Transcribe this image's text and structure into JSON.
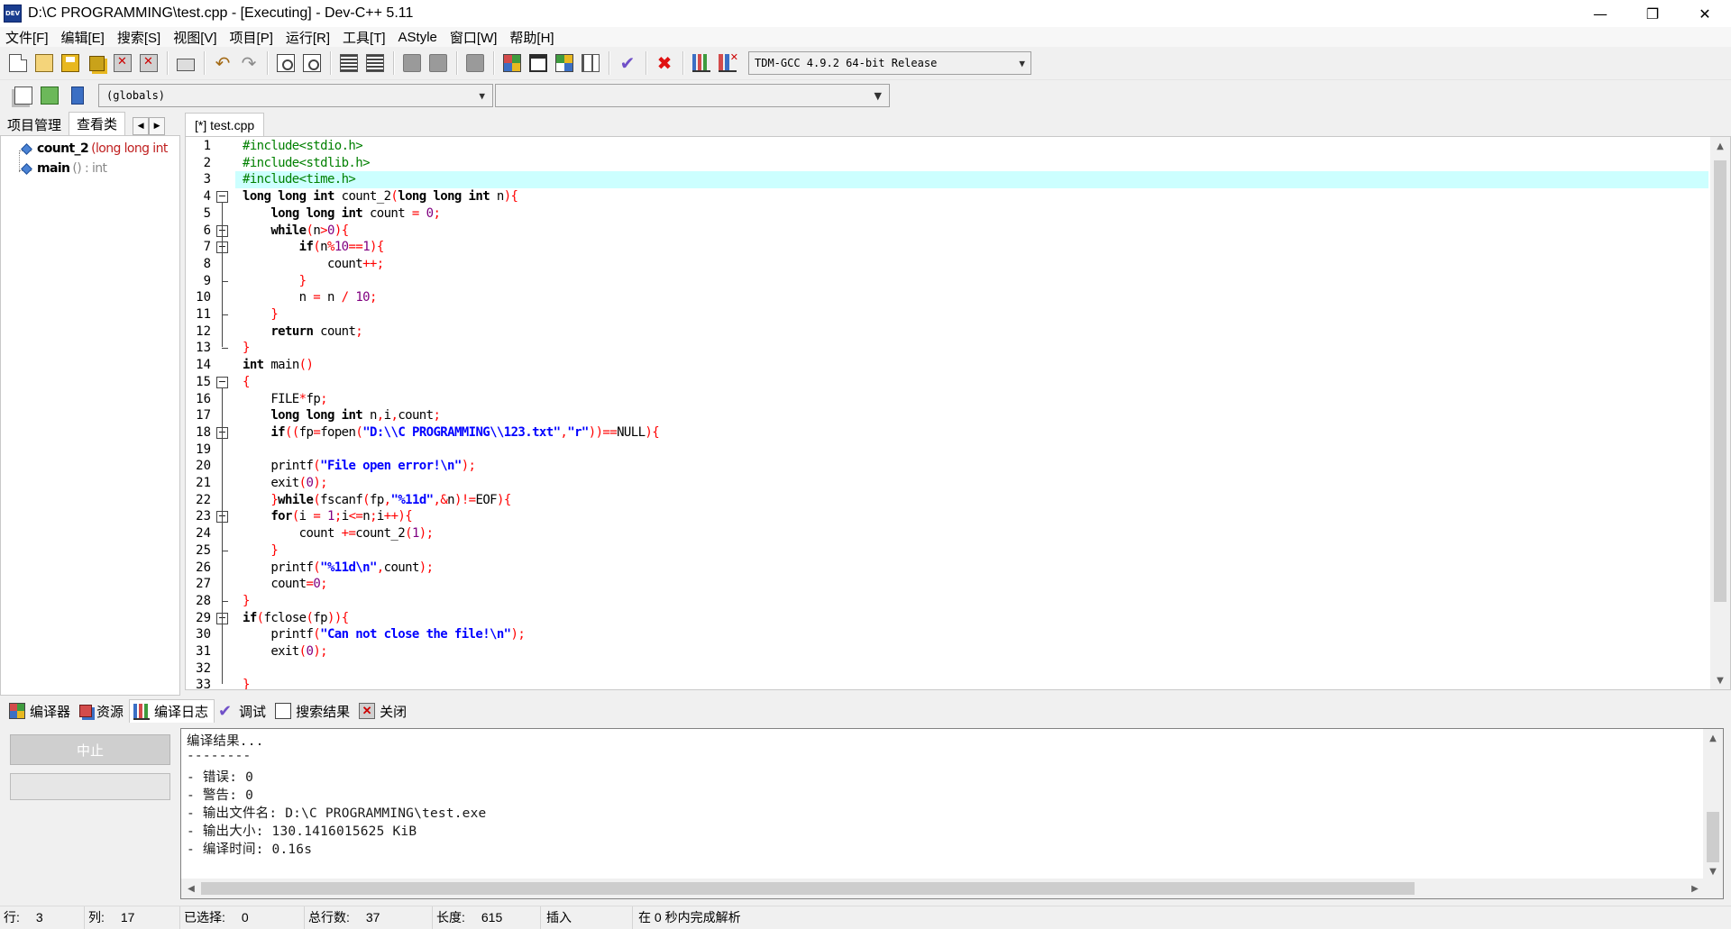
{
  "window": {
    "title": "D:\\C PROGRAMMING\\test.cpp - [Executing] - Dev-C++ 5.11",
    "logo_text": "DEV",
    "controls": {
      "minimize": "—",
      "restore": "❐",
      "close": "✕"
    }
  },
  "menu": [
    "文件[F]",
    "编辑[E]",
    "搜索[S]",
    "视图[V]",
    "项目[P]",
    "运行[R]",
    "工具[T]",
    "AStyle",
    "窗口[W]",
    "帮助[H]"
  ],
  "toolbar": {
    "compiler": "TDM-GCC 4.9.2 64-bit Release",
    "icons": [
      "new-file-icon",
      "open-project-icon",
      "save-icon",
      "save-all-icon",
      "close-file-icon",
      "close-all-icon",
      "print-icon",
      "undo-icon",
      "redo-icon",
      "find-icon",
      "replace-icon",
      "indent-icon",
      "unindent-icon",
      "back-icon",
      "forward-icon",
      "bookmark-icon",
      "compile-icon",
      "run-icon",
      "compile-run-icon",
      "rebuild-icon",
      "syntax-check-icon",
      "stop-icon",
      "profile-icon",
      "delete-profile-icon"
    ]
  },
  "toolbar2": {
    "scope": "(globals)",
    "function": ""
  },
  "left_panel": {
    "tabs": [
      "项目管理",
      "查看类"
    ],
    "active_tab": "查看类",
    "tree": [
      {
        "name": "count_2",
        "detail": "(long long int",
        "color": "#c02020"
      },
      {
        "name": "main",
        "detail": "() : int",
        "color": "#888888"
      }
    ]
  },
  "editor": {
    "tab_label": "[*] test.cpp",
    "current_line": 3,
    "lines": [
      [
        [
          "pp",
          "#include<stdio.h>"
        ]
      ],
      [
        [
          "pp",
          "#include<stdlib.h>"
        ]
      ],
      [
        [
          "pp",
          "#include<time.h>"
        ]
      ],
      [
        [
          "kw",
          "long long int"
        ],
        [
          "plain",
          " count_2"
        ],
        [
          "sym",
          "("
        ],
        [
          "kw",
          "long long int"
        ],
        [
          "plain",
          " n"
        ],
        [
          "sym",
          "){"
        ]
      ],
      [
        [
          "plain",
          "    "
        ],
        [
          "kw",
          "long long int"
        ],
        [
          "plain",
          " count "
        ],
        [
          "sym",
          "="
        ],
        [
          "plain",
          " "
        ],
        [
          "num",
          "0"
        ],
        [
          "sym",
          ";"
        ]
      ],
      [
        [
          "plain",
          "    "
        ],
        [
          "kw",
          "while"
        ],
        [
          "sym",
          "("
        ],
        [
          "plain",
          "n"
        ],
        [
          "sym",
          ">"
        ],
        [
          "num",
          "0"
        ],
        [
          "sym",
          "){"
        ]
      ],
      [
        [
          "plain",
          "        "
        ],
        [
          "kw",
          "if"
        ],
        [
          "sym",
          "("
        ],
        [
          "plain",
          "n"
        ],
        [
          "sym",
          "%"
        ],
        [
          "num",
          "10"
        ],
        [
          "sym",
          "=="
        ],
        [
          "num",
          "1"
        ],
        [
          "sym",
          "){"
        ]
      ],
      [
        [
          "plain",
          "            count"
        ],
        [
          "sym",
          "++;"
        ]
      ],
      [
        [
          "plain",
          "        "
        ],
        [
          "sym",
          "}"
        ]
      ],
      [
        [
          "plain",
          "        n "
        ],
        [
          "sym",
          "="
        ],
        [
          "plain",
          " n "
        ],
        [
          "sym",
          "/"
        ],
        [
          "plain",
          " "
        ],
        [
          "num",
          "10"
        ],
        [
          "sym",
          ";"
        ]
      ],
      [
        [
          "plain",
          "    "
        ],
        [
          "sym",
          "}"
        ]
      ],
      [
        [
          "plain",
          "    "
        ],
        [
          "kw",
          "return"
        ],
        [
          "plain",
          " count"
        ],
        [
          "sym",
          ";"
        ]
      ],
      [
        [
          "sym",
          "}"
        ]
      ],
      [
        [
          "kw",
          "int"
        ],
        [
          "plain",
          " main"
        ],
        [
          "sym",
          "()"
        ]
      ],
      [
        [
          "sym",
          "{"
        ]
      ],
      [
        [
          "plain",
          "    FILE"
        ],
        [
          "sym",
          "*"
        ],
        [
          "plain",
          "fp"
        ],
        [
          "sym",
          ";"
        ]
      ],
      [
        [
          "plain",
          "    "
        ],
        [
          "kw",
          "long long int"
        ],
        [
          "plain",
          " n"
        ],
        [
          "sym",
          ","
        ],
        [
          "plain",
          "i"
        ],
        [
          "sym",
          ","
        ],
        [
          "plain",
          "count"
        ],
        [
          "sym",
          ";"
        ]
      ],
      [
        [
          "plain",
          "    "
        ],
        [
          "kw",
          "if"
        ],
        [
          "sym",
          "(("
        ],
        [
          "plain",
          "fp"
        ],
        [
          "sym",
          "="
        ],
        [
          "plain",
          "fopen"
        ],
        [
          "sym",
          "("
        ],
        [
          "str",
          "\"D:\\\\C PROGRAMMING\\\\123.txt\""
        ],
        [
          "sym",
          ","
        ],
        [
          "str",
          "\"r\""
        ],
        [
          "sym",
          "))=="
        ],
        [
          "plain",
          "NULL"
        ],
        [
          "sym",
          "){"
        ]
      ],
      [],
      [
        [
          "plain",
          "    printf"
        ],
        [
          "sym",
          "("
        ],
        [
          "str",
          "\"File open error!\\n\""
        ],
        [
          "sym",
          ");"
        ]
      ],
      [
        [
          "plain",
          "    exit"
        ],
        [
          "sym",
          "("
        ],
        [
          "num",
          "0"
        ],
        [
          "sym",
          ");"
        ]
      ],
      [
        [
          "plain",
          "    "
        ],
        [
          "sym",
          "}"
        ],
        [
          "kw",
          "while"
        ],
        [
          "sym",
          "("
        ],
        [
          "plain",
          "fscanf"
        ],
        [
          "sym",
          "("
        ],
        [
          "plain",
          "fp"
        ],
        [
          "sym",
          ","
        ],
        [
          "str",
          "\"%11d\""
        ],
        [
          "sym",
          ",&"
        ],
        [
          "plain",
          "n"
        ],
        [
          "sym",
          ")!="
        ],
        [
          "plain",
          "EOF"
        ],
        [
          "sym",
          "){"
        ]
      ],
      [
        [
          "plain",
          "    "
        ],
        [
          "kw",
          "for"
        ],
        [
          "sym",
          "("
        ],
        [
          "plain",
          "i "
        ],
        [
          "sym",
          "="
        ],
        [
          "plain",
          " "
        ],
        [
          "num",
          "1"
        ],
        [
          "sym",
          ";"
        ],
        [
          "plain",
          "i"
        ],
        [
          "sym",
          "<="
        ],
        [
          "plain",
          "n"
        ],
        [
          "sym",
          ";"
        ],
        [
          "plain",
          "i"
        ],
        [
          "sym",
          "++){"
        ]
      ],
      [
        [
          "plain",
          "        count "
        ],
        [
          "sym",
          "+="
        ],
        [
          "plain",
          "count_2"
        ],
        [
          "sym",
          "("
        ],
        [
          "num",
          "1"
        ],
        [
          "sym",
          ");"
        ]
      ],
      [
        [
          "plain",
          "    "
        ],
        [
          "sym",
          "}"
        ]
      ],
      [
        [
          "plain",
          "    printf"
        ],
        [
          "sym",
          "("
        ],
        [
          "str",
          "\"%11d\\n\""
        ],
        [
          "sym",
          ","
        ],
        [
          "plain",
          "count"
        ],
        [
          "sym",
          ");"
        ]
      ],
      [
        [
          "plain",
          "    count"
        ],
        [
          "sym",
          "="
        ],
        [
          "num",
          "0"
        ],
        [
          "sym",
          ";"
        ]
      ],
      [
        [
          "sym",
          "}"
        ]
      ],
      [
        [
          "kw",
          "if"
        ],
        [
          "sym",
          "("
        ],
        [
          "plain",
          "fclose"
        ],
        [
          "sym",
          "("
        ],
        [
          "plain",
          "fp"
        ],
        [
          "sym",
          "))"
        ],
        [
          "sym",
          "{"
        ]
      ],
      [
        [
          "plain",
          "    printf"
        ],
        [
          "sym",
          "("
        ],
        [
          "str",
          "\"Can not close the file!\\n\""
        ],
        [
          "sym",
          ");"
        ]
      ],
      [
        [
          "plain",
          "    exit"
        ],
        [
          "sym",
          "("
        ],
        [
          "num",
          "0"
        ],
        [
          "sym",
          ");"
        ]
      ],
      [],
      [
        [
          "sym",
          "}"
        ]
      ]
    ]
  },
  "bottom": {
    "tabs": [
      "编译器",
      "资源",
      "编译日志",
      "调试",
      "搜索结果",
      "关闭"
    ],
    "active_tab": "编译日志",
    "stop_label": "中止",
    "log": [
      "编译结果...",
      "--------",
      "- 错误: 0",
      "- 警告: 0",
      "- 输出文件名: D:\\C PROGRAMMING\\test.exe",
      "- 输出大小: 130.1416015625 KiB",
      "- 编译时间: 0.16s"
    ]
  },
  "status": {
    "row_label": "行:",
    "row": "3",
    "col_label": "列:",
    "col": "17",
    "sel_label": "已选择:",
    "sel": "0",
    "total_label": "总行数:",
    "total": "37",
    "len_label": "长度:",
    "len": "615",
    "mode": "插入",
    "parse": "在 0 秒内完成解析"
  }
}
